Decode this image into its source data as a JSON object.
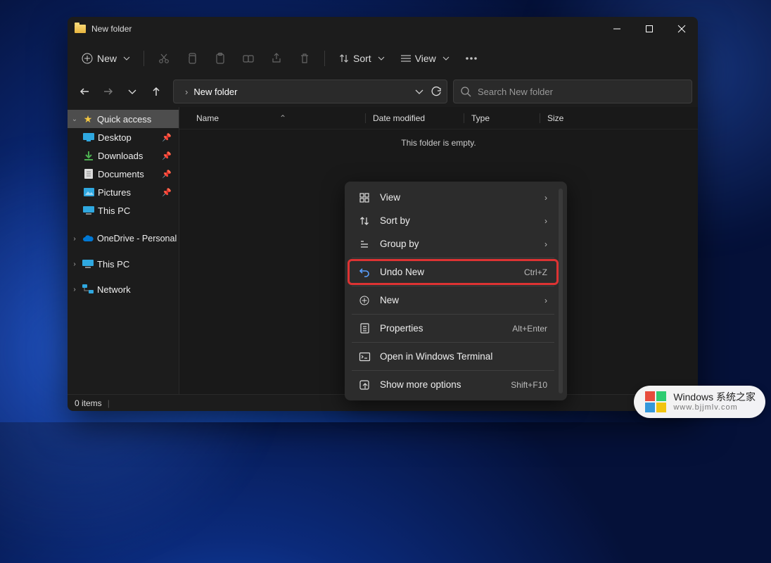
{
  "window": {
    "title": "New folder"
  },
  "toolbar": {
    "new_label": "New",
    "sort_label": "Sort",
    "view_label": "View"
  },
  "address": {
    "folder": "New folder",
    "separator": "›"
  },
  "search": {
    "placeholder": "Search New folder"
  },
  "sidebar": {
    "quick_access": "Quick access",
    "desktop": "Desktop",
    "downloads": "Downloads",
    "documents": "Documents",
    "pictures": "Pictures",
    "this_pc_pinned": "This PC",
    "onedrive": "OneDrive - Personal",
    "this_pc": "This PC",
    "network": "Network"
  },
  "columns": {
    "name": "Name",
    "date": "Date modified",
    "type": "Type",
    "size": "Size"
  },
  "content": {
    "empty": "This folder is empty."
  },
  "status": {
    "items": "0 items"
  },
  "context_menu": {
    "view": "View",
    "sort_by": "Sort by",
    "group_by": "Group by",
    "undo": "Undo New",
    "undo_key": "Ctrl+Z",
    "new": "New",
    "properties": "Properties",
    "properties_key": "Alt+Enter",
    "terminal": "Open in Windows Terminal",
    "more": "Show more options",
    "more_key": "Shift+F10"
  },
  "watermark": {
    "line1": "Windows 系统之家",
    "line2": "www.bjjmlv.com"
  }
}
